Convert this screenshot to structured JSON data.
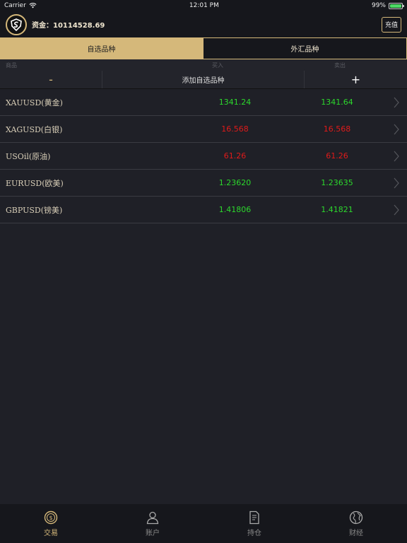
{
  "status": {
    "carrier": "Carrier",
    "time": "12:01 PM",
    "battery": "99%"
  },
  "header": {
    "funds_label": "资金：",
    "funds_value": "10114528.69",
    "recharge_label": "充值"
  },
  "tabs": [
    {
      "label": "自选品种",
      "active": true
    },
    {
      "label": "外汇品种",
      "active": false
    }
  ],
  "columns": {
    "product": "商品",
    "buy": "买入",
    "sell": "卖出"
  },
  "actions": {
    "minus": "-",
    "add_label": "添加自选品种",
    "plus": "+"
  },
  "rows": [
    {
      "name": "XAUUSD(黄金)",
      "buy": "1341.24",
      "sell": "1341.64",
      "trend": "up"
    },
    {
      "name": "XAGUSD(白银)",
      "buy": "16.568",
      "sell": "16.568",
      "trend": "down"
    },
    {
      "name": "USOil(原油)",
      "buy": "61.26",
      "sell": "61.26",
      "trend": "down"
    },
    {
      "name": "EURUSD(欧美)",
      "buy": "1.23620",
      "sell": "1.23635",
      "trend": "up"
    },
    {
      "name": "GBPUSD(镑美)",
      "buy": "1.41806",
      "sell": "1.41821",
      "trend": "up"
    }
  ],
  "tabbar": [
    {
      "label": "交易",
      "icon": "coin-icon",
      "active": true
    },
    {
      "label": "账户",
      "icon": "user-icon",
      "active": false
    },
    {
      "label": "持仓",
      "icon": "document-icon",
      "active": false
    },
    {
      "label": "财经",
      "icon": "globe-icon",
      "active": false
    }
  ],
  "colors": {
    "accent": "#d5b87a",
    "up": "#2cd82c",
    "down": "#e01a1a",
    "background": "#1f2027"
  }
}
